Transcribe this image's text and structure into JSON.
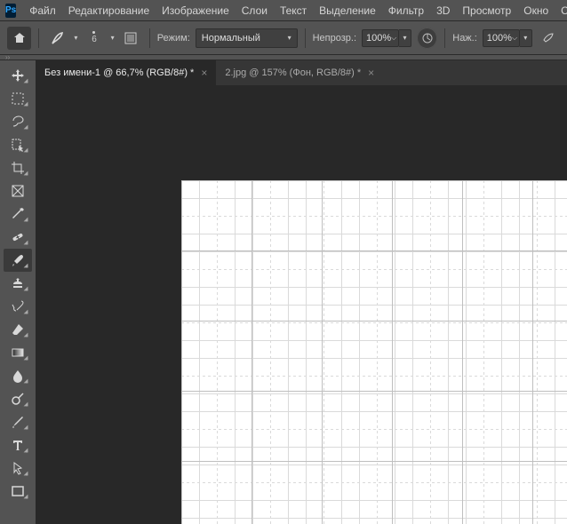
{
  "app_badge": "Ps",
  "menu": [
    "Файл",
    "Редактирование",
    "Изображение",
    "Слои",
    "Текст",
    "Выделение",
    "Фильтр",
    "3D",
    "Просмотр",
    "Окно",
    "Справ"
  ],
  "options": {
    "brush_size": "6",
    "mode_label": "Режим:",
    "blend_mode": "Нормальный",
    "opacity_label": "Непрозр.:",
    "opacity_value": "100%",
    "flow_label": "Наж.:",
    "flow_value": "100%"
  },
  "tabs": [
    {
      "label": "Без имени-1 @ 66,7% (RGB/8#) *",
      "active": true
    },
    {
      "label": "2.jpg @ 157% (Фон, RGB/8#) *",
      "active": false
    }
  ],
  "stripe_marker": "››",
  "tool_names": [
    "move-tool",
    "marquee-tool",
    "lasso-tool",
    "quick-select-tool",
    "crop-tool",
    "frame-tool",
    "eyedropper-tool",
    "healing-brush-tool",
    "brush-tool",
    "clone-stamp-tool",
    "history-brush-tool",
    "eraser-tool",
    "gradient-tool",
    "blur-tool",
    "dodge-tool",
    "pen-tool",
    "type-tool",
    "path-select-tool",
    "rectangle-tool"
  ]
}
